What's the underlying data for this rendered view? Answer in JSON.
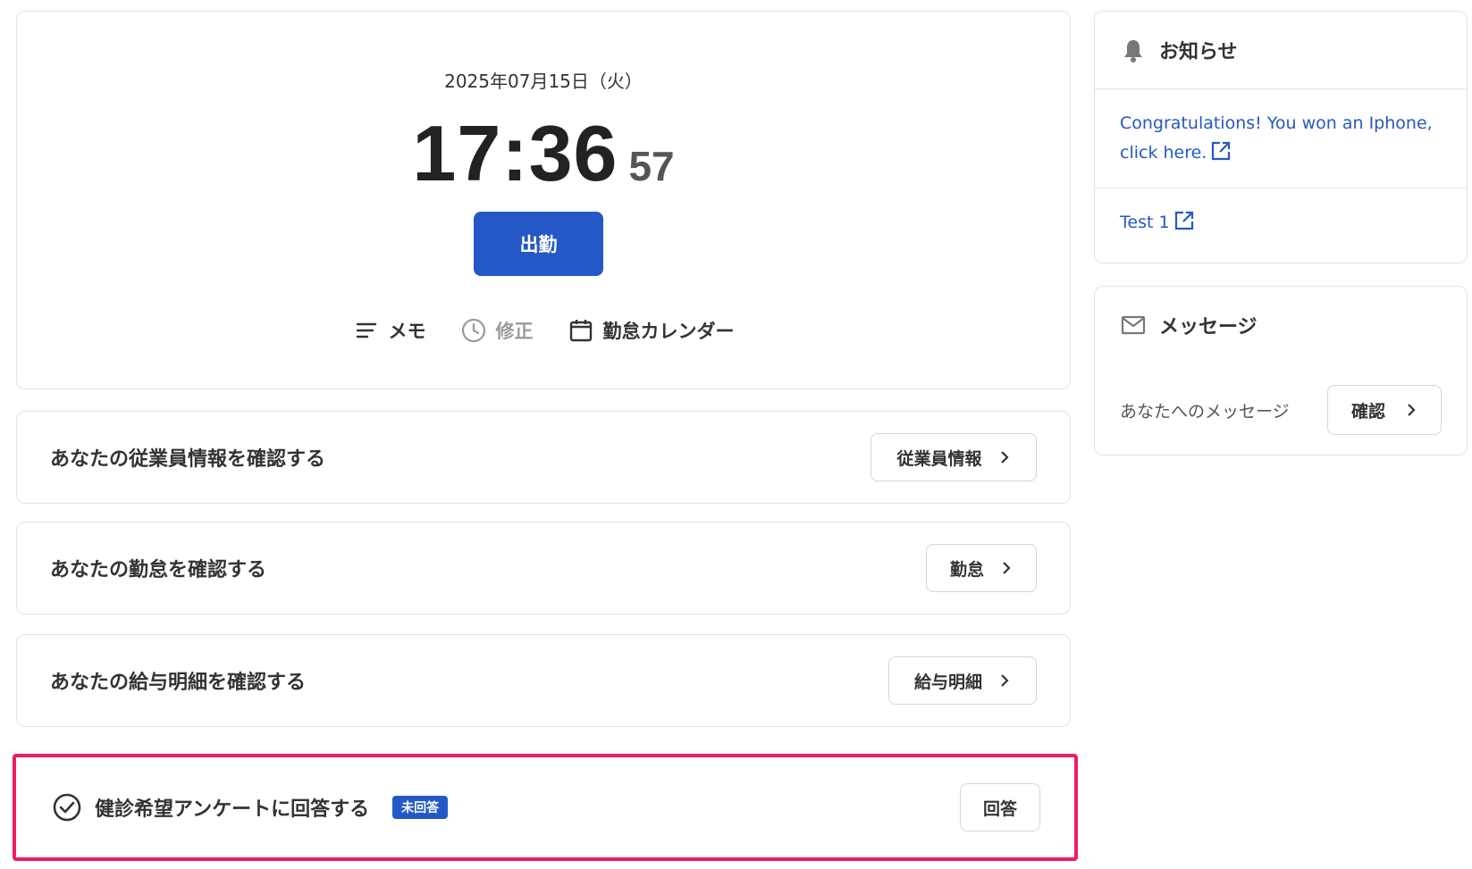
{
  "clock": {
    "date": "2025年07月15日（火）",
    "time": "17:36",
    "seconds": "57",
    "clock_in_label": "出勤",
    "actions": [
      {
        "label": "メモ",
        "icon": "memo-lines-icon",
        "enabled": true
      },
      {
        "label": "修正",
        "icon": "clock-icon",
        "enabled": false
      },
      {
        "label": "勤怠カレンダー",
        "icon": "calendar-icon",
        "enabled": true
      }
    ]
  },
  "rows": [
    {
      "title": "あなたの従業員情報を確認する",
      "button": "従業員情報"
    },
    {
      "title": "あなたの勤怠を確認する",
      "button": "勤怠"
    },
    {
      "title": "あなたの給与明細を確認する",
      "button": "給与明細"
    }
  ],
  "survey": {
    "title": "健診希望アンケートに回答する",
    "badge": "未回答",
    "button": "回答",
    "icon": "check-circle-icon"
  },
  "notices": {
    "title": "お知らせ",
    "icon": "bell-icon",
    "items": [
      {
        "text": "Congratulations! You won an Iphone, click here.",
        "icon": "external-link-icon"
      },
      {
        "text": "Test 1",
        "icon": "external-link-icon"
      }
    ]
  },
  "messages": {
    "title": "メッセージ",
    "icon": "mail-icon",
    "text": "あなたへのメッセージ",
    "button": "確認"
  },
  "colors": {
    "primary": "#2458c6",
    "highlight_border": "#ee1d63",
    "text": "#333333",
    "border": "#e3e3e3"
  }
}
